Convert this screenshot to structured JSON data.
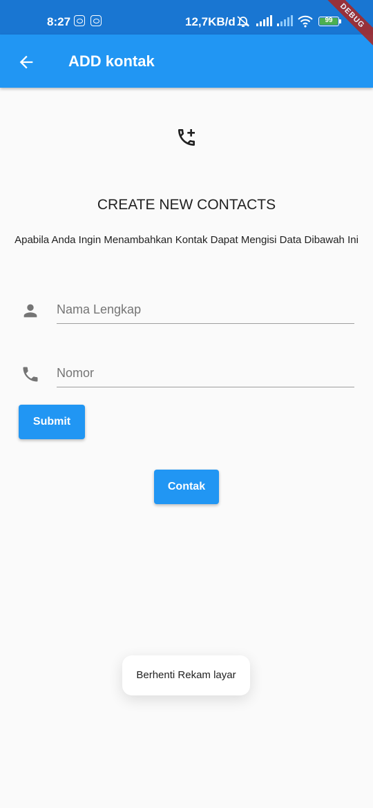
{
  "status_bar": {
    "time": "8:27",
    "network_speed": "12,7KB/d",
    "battery_level": "99",
    "icons": [
      "cat-notification-icon",
      "cat-notification-icon",
      "alarm-off-icon",
      "signal-icon",
      "signal-weak-icon",
      "wifi-icon",
      "battery-icon"
    ]
  },
  "debug_banner": "DEBUG",
  "app_bar": {
    "back_icon": "arrow-back-icon",
    "title": "ADD kontak",
    "color": "#2196f3"
  },
  "header": {
    "icon": "add-call-icon",
    "title": "CREATE NEW CONTACTS",
    "description": "Apabila Anda Ingin Menambahkan Kontak Dapat Mengisi Data Dibawah Ini"
  },
  "form": {
    "name_field": {
      "icon": "person-icon",
      "placeholder": "Nama Lengkap",
      "value": ""
    },
    "phone_field": {
      "icon": "phone-icon",
      "placeholder": "Nomor",
      "value": ""
    },
    "submit_label": "Submit"
  },
  "contacts_button_label": "Contak",
  "toast": {
    "message": "Berhenti Rekam layar"
  }
}
